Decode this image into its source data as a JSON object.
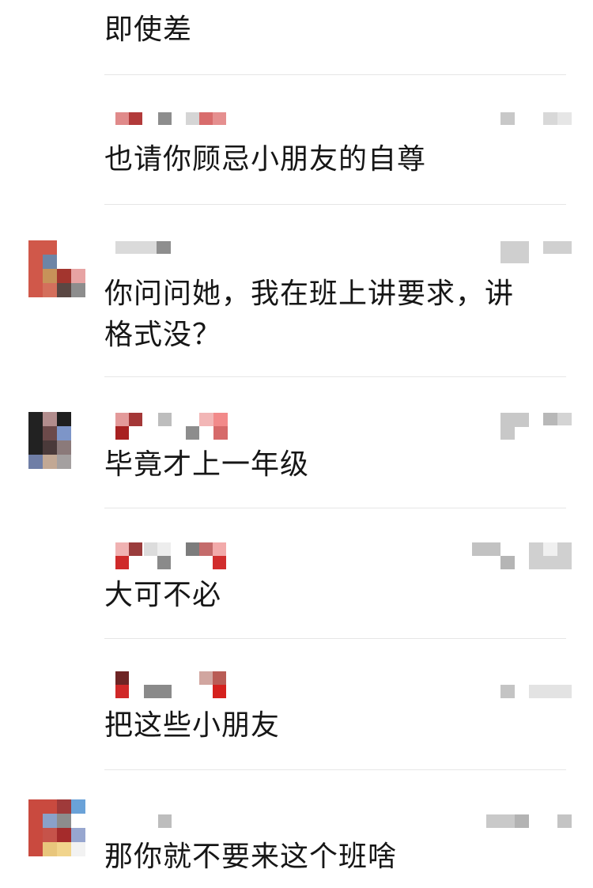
{
  "messages": [
    {
      "text": "即使差"
    },
    {
      "text": "也请你顾忌小朋友的自尊"
    },
    {
      "text": "你问问她，我在班上讲要求，讲\n格式没？"
    },
    {
      "text": "毕竟才上一年级"
    },
    {
      "text": "大可不必"
    },
    {
      "text": "把这些小朋友"
    },
    {
      "text": "那你就不要来这个班啥"
    }
  ]
}
